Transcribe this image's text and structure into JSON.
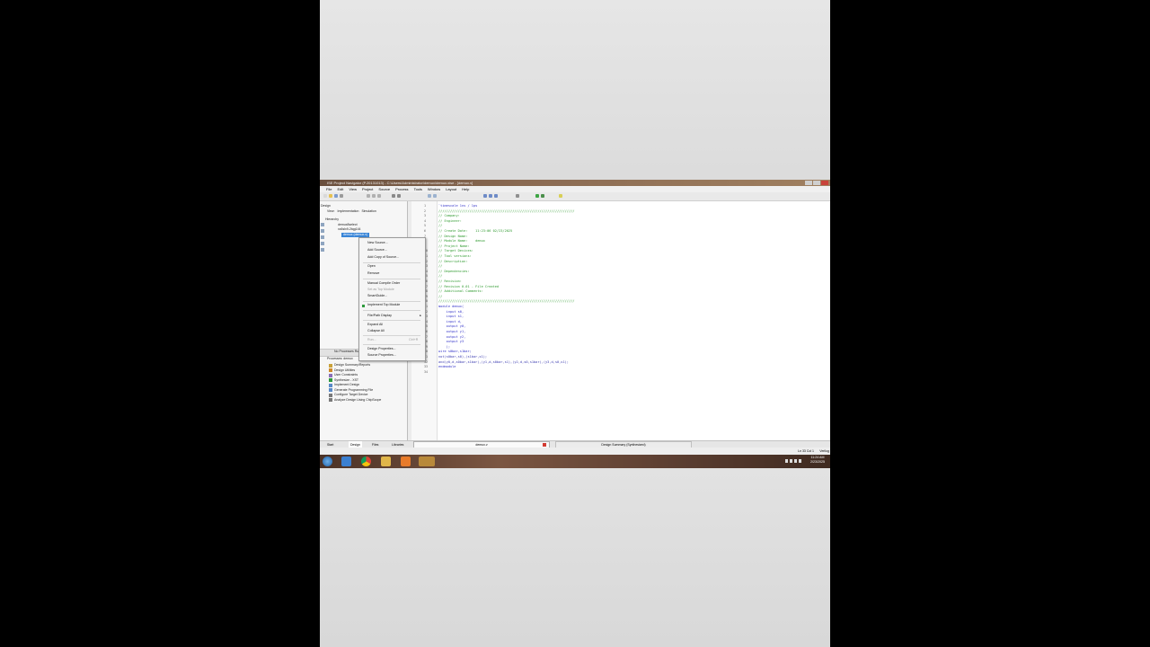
{
  "window": {
    "title": "ISE Project Navigator (P.20131013) - C:\\Users\\Administrator\\demux\\demux.xise - [demux.v]"
  },
  "menu": [
    "File",
    "Edit",
    "View",
    "Project",
    "Source",
    "Process",
    "Tools",
    "Window",
    "Layout",
    "Help"
  ],
  "left_panel": {
    "header": "Design",
    "view_label": "View:",
    "implementation": "Implementation",
    "simulation": "Simulation",
    "hierarchy_label": "Hierarchy",
    "tree": [
      "demux8select",
      "xc6slx9-2tqg144",
      "demux (demux.v)"
    ]
  },
  "context_menu": {
    "items": [
      {
        "label": "New Source...",
        "disabled": false
      },
      {
        "label": "Add Source...",
        "disabled": false
      },
      {
        "label": "Add Copy of Source...",
        "disabled": false
      },
      {
        "label": "Open",
        "disabled": false
      },
      {
        "label": "Remove",
        "disabled": false
      },
      {
        "label": "Manual Compile Order",
        "disabled": false
      },
      {
        "label": "Set as Top Module",
        "disabled": true
      },
      {
        "label": "SmartGuide...",
        "disabled": false
      },
      {
        "label": "Implement Top Module",
        "disabled": false
      },
      {
        "label": "File/Path Display",
        "disabled": false
      },
      {
        "label": "Expand All",
        "disabled": false
      },
      {
        "label": "Collapse All",
        "disabled": false
      },
      {
        "label": "Run...",
        "disabled": true
      },
      {
        "label": "Design Properties...",
        "disabled": false
      },
      {
        "label": "Source Properties...",
        "disabled": false
      }
    ],
    "shortcut_run": "Ctrl+R"
  },
  "processes": {
    "bar_label": "No Processes Running",
    "header": "Processes: demux",
    "items": [
      "Design Summary/Reports",
      "Design Utilities",
      "User Constraints",
      "Synthesize - XST",
      "Implement Design",
      "Generate Programming File",
      "Configure Target Device",
      "Analyze Design Using ChipScope"
    ]
  },
  "code_lines": [
    "`timescale 1ns / 1ps",
    "//////////////////////////////////////////////////////////////////////",
    "// Company:",
    "// Engineer:",
    "//",
    "// Create Date:    11:23:06 02/23/2025",
    "// Design Name:",
    "// Module Name:    demux",
    "// Project Name:",
    "// Target Devices:",
    "// Tool versions:",
    "// Description:",
    "//",
    "// Dependencies:",
    "//",
    "// Revision:",
    "// Revision 0.01 - File Created",
    "// Additional Comments:",
    "//",
    "//////////////////////////////////////////////////////////////////////",
    "module demux(",
    "    input s0,",
    "    input s1,",
    "    input d,",
    "    output y0,",
    "    output y1,",
    "    output y2,",
    "    output y3",
    "    );",
    "wire s0bar,s1bar;",
    "not(s0bar,s0),(s1bar,s1);",
    "and(y0,d,s0bar,s1bar),(y1,d,s0bar,s1),(y2,d,s0,s1bar),(y3,d,s0,s1);",
    "endmodule",
    ""
  ],
  "bottom_tabs": [
    "Start",
    "Design",
    "Files",
    "Libraries"
  ],
  "editor_tabs": [
    "demux.v",
    "Design Summary (Synthesized)"
  ],
  "status": {
    "position": "Ln 33 Col 1",
    "language": "Verilog"
  },
  "taskbar": {
    "time": "11:24 AM",
    "date": "2/23/2025"
  },
  "colors": {
    "comment": "#2f9a2f",
    "keyword": "#3030c8",
    "selection": "#3a86d8"
  }
}
